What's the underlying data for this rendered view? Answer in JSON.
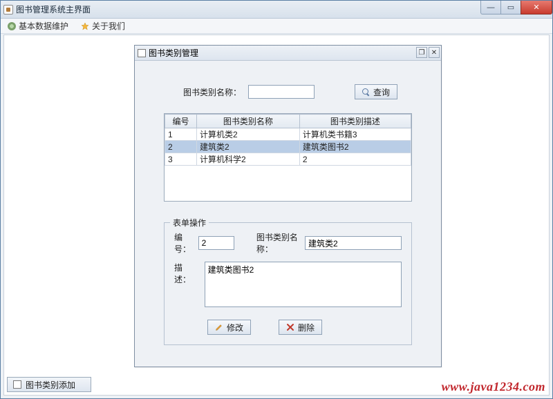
{
  "outer_window": {
    "title": "图书管理系统主界面"
  },
  "menubar": {
    "item1": "基本数据维护",
    "item2": "关于我们"
  },
  "internal_frame": {
    "title": "图书类别管理"
  },
  "search": {
    "label": "图书类别名称：",
    "value": "",
    "button": "查询"
  },
  "table": {
    "headers": {
      "c1": "编号",
      "c2": "图书类别名称",
      "c3": "图书类别描述"
    },
    "rows": [
      {
        "id": "1",
        "name": "计算机类2",
        "desc": "计算机类书籍3"
      },
      {
        "id": "2",
        "name": "建筑类2",
        "desc": "建筑类图书2"
      },
      {
        "id": "3",
        "name": "计算机科学2",
        "desc": "2"
      }
    ],
    "selected_index": 1
  },
  "form": {
    "legend": "表单操作",
    "id_label": "编号：",
    "id_value": "2",
    "name_label": "图书类别名称：",
    "name_value": "建筑类2",
    "desc_label": "描述：",
    "desc_value": "建筑类图书2",
    "modify_button": "修改",
    "delete_button": "删除"
  },
  "taskbar": {
    "button": "图书类别添加"
  },
  "watermark": "www.java1234.com"
}
